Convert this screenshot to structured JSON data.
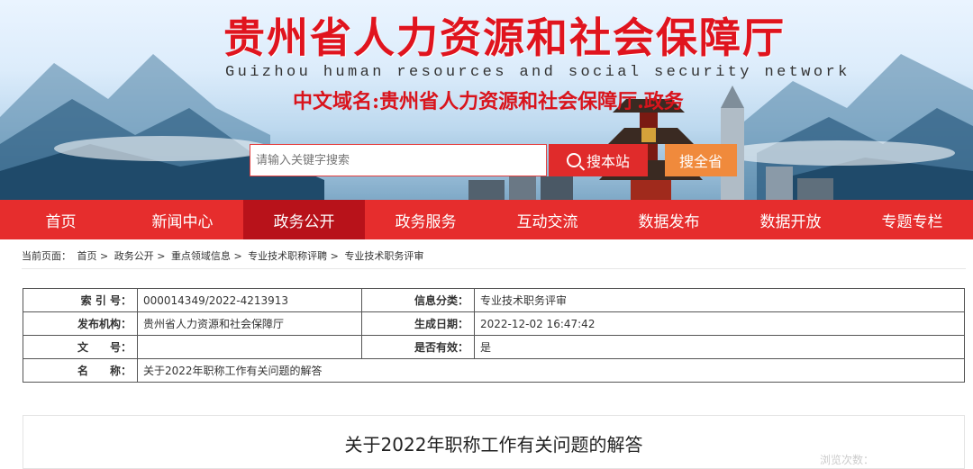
{
  "header": {
    "title": "贵州省人力资源和社会保障厅",
    "subtitle": "Guizhou human resources and social security network",
    "domain_line": "中文域名:贵州省人力资源和社会保障厅.政务"
  },
  "search": {
    "placeholder": "请输入关键字搜索",
    "site_button": "搜本站",
    "all_button": "搜全省"
  },
  "nav": [
    {
      "label": "首页"
    },
    {
      "label": "新闻中心"
    },
    {
      "label": "政务公开"
    },
    {
      "label": "政务服务"
    },
    {
      "label": "互动交流"
    },
    {
      "label": "数据发布"
    },
    {
      "label": "数据开放"
    },
    {
      "label": "专题专栏"
    }
  ],
  "active_nav_index": 2,
  "breadcrumb": {
    "prefix": "当前页面：",
    "items": [
      "首页",
      "政务公开",
      "重点领域信息",
      "专业技术职称评聘",
      "专业技术职务评审"
    ],
    "separator": ">"
  },
  "info": {
    "index_label": "索 引 号：",
    "index_value": "000014349/2022-4213913",
    "category_label": "信息分类：",
    "category_value": "专业技术职务评审",
    "publisher_label": "发布机构：",
    "publisher_value": "贵州省人力资源和社会保障厅",
    "date_label": "生成日期：",
    "date_value": "2022-12-02 16:47:42",
    "docno_label": "文　　号：",
    "docno_value": "",
    "valid_label": "是否有效：",
    "valid_value": "是",
    "name_label": "名　　称：",
    "name_value": "关于2022年职称工作有关问题的解答"
  },
  "article": {
    "title": "关于2022年职称工作有关问题的解答",
    "faded_text": "浏览次数："
  },
  "colors": {
    "brand_red": "#e62d2d",
    "active_red": "#b8121a",
    "title_red": "#e0141e",
    "search_orange": "#f08a3c"
  }
}
